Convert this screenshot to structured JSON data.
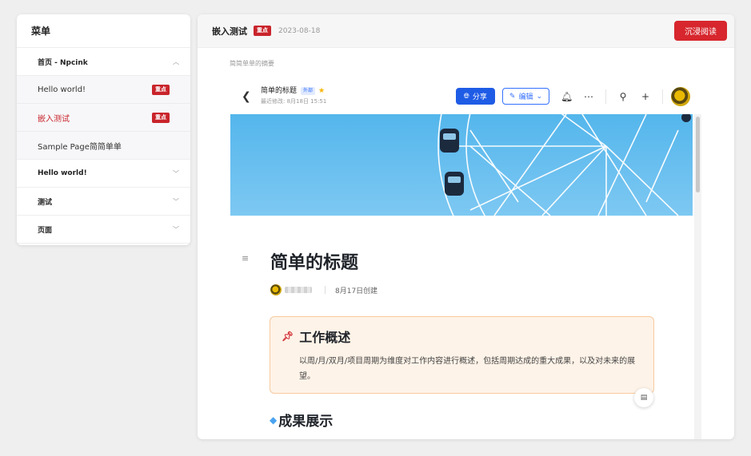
{
  "sidebar": {
    "title": "菜单",
    "groups": [
      {
        "label": "首页 - Npcink",
        "expanded": true,
        "items": [
          {
            "label": "Hello world!",
            "badge": "重点",
            "active": false
          },
          {
            "label": "嵌入测试",
            "badge": "重点",
            "active": true
          },
          {
            "label": "Sample Page简简单单",
            "badge": "",
            "active": false
          }
        ]
      },
      {
        "label": "Hello world!",
        "expanded": false
      },
      {
        "label": "测试",
        "expanded": false
      },
      {
        "label": "页面",
        "expanded": false
      }
    ]
  },
  "header": {
    "title": "嵌入测试",
    "badge": "重点",
    "date": "2023-08-18",
    "immersive_label": "沉浸阅读"
  },
  "summary": "简简单单的摘要",
  "doc": {
    "name": "简单的标题",
    "tag": "外部",
    "modified": "最近修改: 8月18日 15:51",
    "share_label": "分享",
    "edit_label": "编辑",
    "heading": "简单的标题",
    "created": "8月17日创建",
    "callout_title": "工作概述",
    "callout_text": "以周/月/双月/项目周期为维度对工作内容进行概述，包括周期达成的重大成果，以及对未来的展望。",
    "section_heading": "成果展示"
  },
  "colors": {
    "accent_red": "#d7262d",
    "primary_blue": "#1f5ce6",
    "callout_bg": "#fef3e8"
  }
}
